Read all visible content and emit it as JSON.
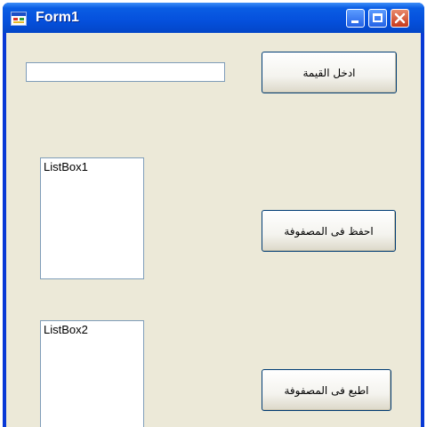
{
  "window": {
    "title": "Form1",
    "icons": {
      "app": "form-app-icon",
      "minimize": "minimize-icon",
      "maximize": "maximize-icon",
      "close": "close-icon"
    },
    "colors": {
      "titlebar": "#0550dc",
      "client_background": "#ece9d8",
      "close_button": "#c7391c"
    }
  },
  "form": {
    "value_input": {
      "value": "",
      "placeholder": ""
    },
    "enter_value_button": {
      "label": "ادخل القيمة"
    },
    "save_in_array_button": {
      "label": "احفظ فى المصفوفة"
    },
    "print_array_button": {
      "label": "اطبع فى المصفوفة"
    },
    "listbox1": {
      "items": [
        "ListBox1"
      ]
    },
    "listbox2": {
      "items": [
        "ListBox2"
      ]
    }
  }
}
